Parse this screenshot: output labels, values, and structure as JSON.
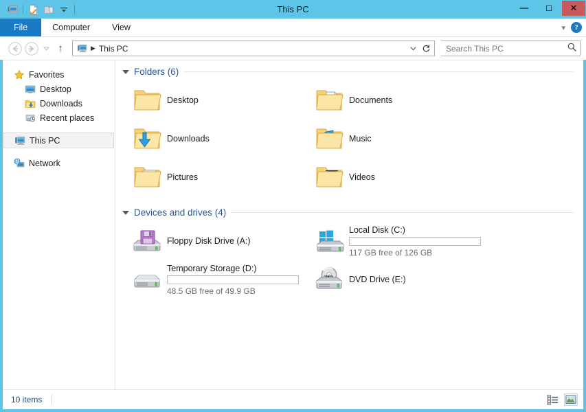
{
  "window": {
    "title": "This PC",
    "accent_titlebar": "#5ec5e8",
    "accent_close": "#c75b5b",
    "accent_tab_file": "#1b7ac4",
    "controls": {
      "minimize": "—",
      "maximize": "☐",
      "close": "X"
    }
  },
  "quick_access": {
    "items": [
      {
        "name": "this-pc-icon",
        "label": "This PC"
      },
      {
        "name": "properties-icon",
        "label": "Properties"
      },
      {
        "name": "new-folder-icon",
        "label": "New folder"
      },
      {
        "name": "customize-dropdown-icon",
        "label": "Customize Quick Access Toolbar"
      }
    ]
  },
  "ribbon": {
    "tabs": [
      {
        "label": "File",
        "active": true
      },
      {
        "label": "Computer",
        "active": false
      },
      {
        "label": "View",
        "active": false
      }
    ],
    "expand_chevron": "⌄",
    "help_label": "?"
  },
  "address": {
    "back_label": "Back",
    "forward_label": "Forward",
    "recent_label": "Recent locations",
    "up_label": "Up",
    "up_glyph": "↑",
    "crumb_icon": "this-pc-icon",
    "crumbs": [
      "This PC"
    ],
    "separator": "▶",
    "dropdown_glyph": "⌄",
    "refresh_glyph": "↻"
  },
  "search": {
    "value": "",
    "placeholder": "Search This PC",
    "icon": "search-icon"
  },
  "sidebar": {
    "groups": [
      {
        "name": "favorites",
        "header": {
          "label": "Favorites",
          "icon": "star-icon"
        },
        "items": [
          {
            "label": "Desktop",
            "icon": "desktop-icon"
          },
          {
            "label": "Downloads",
            "icon": "downloads-folder-icon"
          },
          {
            "label": "Recent places",
            "icon": "recent-places-icon"
          }
        ]
      },
      {
        "name": "this-pc",
        "header": {
          "label": "This PC",
          "icon": "this-pc-icon",
          "selected": true
        },
        "items": []
      },
      {
        "name": "network",
        "header": {
          "label": "Network",
          "icon": "network-icon"
        },
        "items": []
      }
    ]
  },
  "main": {
    "groups": [
      {
        "name": "folders",
        "title": "Folders (6)",
        "count": 6,
        "items": [
          {
            "label": "Desktop",
            "icon": "folder-desktop-icon"
          },
          {
            "label": "Documents",
            "icon": "folder-documents-icon"
          },
          {
            "label": "Downloads",
            "icon": "folder-downloads-icon"
          },
          {
            "label": "Music",
            "icon": "folder-music-icon"
          },
          {
            "label": "Pictures",
            "icon": "folder-pictures-icon"
          },
          {
            "label": "Videos",
            "icon": "folder-videos-icon"
          }
        ]
      },
      {
        "name": "devices-and-drives",
        "title": "Devices and drives (4)",
        "count": 4,
        "items": [
          {
            "label": "Floppy Disk Drive (A:)",
            "icon": "floppy-drive-icon",
            "has_bar": false
          },
          {
            "label": "Local Disk (C:)",
            "icon": "windows-drive-icon",
            "has_bar": true,
            "free_text": "117 GB free of 126 GB",
            "free_gb": 117,
            "total_gb": 126,
            "used_percent": 7
          },
          {
            "label": "Temporary Storage (D:)",
            "icon": "hard-drive-icon",
            "has_bar": true,
            "free_text": "48.5 GB free of 49.9 GB",
            "free_gb": 48.5,
            "total_gb": 49.9,
            "used_percent": 3
          },
          {
            "label": "DVD Drive (E:)",
            "icon": "dvd-drive-icon",
            "has_bar": false
          }
        ]
      }
    ]
  },
  "statusbar": {
    "item_count_text": "10 items",
    "views": [
      {
        "name": "details-view-button",
        "label": "Details view",
        "active": false
      },
      {
        "name": "large-icons-view-button",
        "label": "Large icons view",
        "active": true
      }
    ]
  }
}
